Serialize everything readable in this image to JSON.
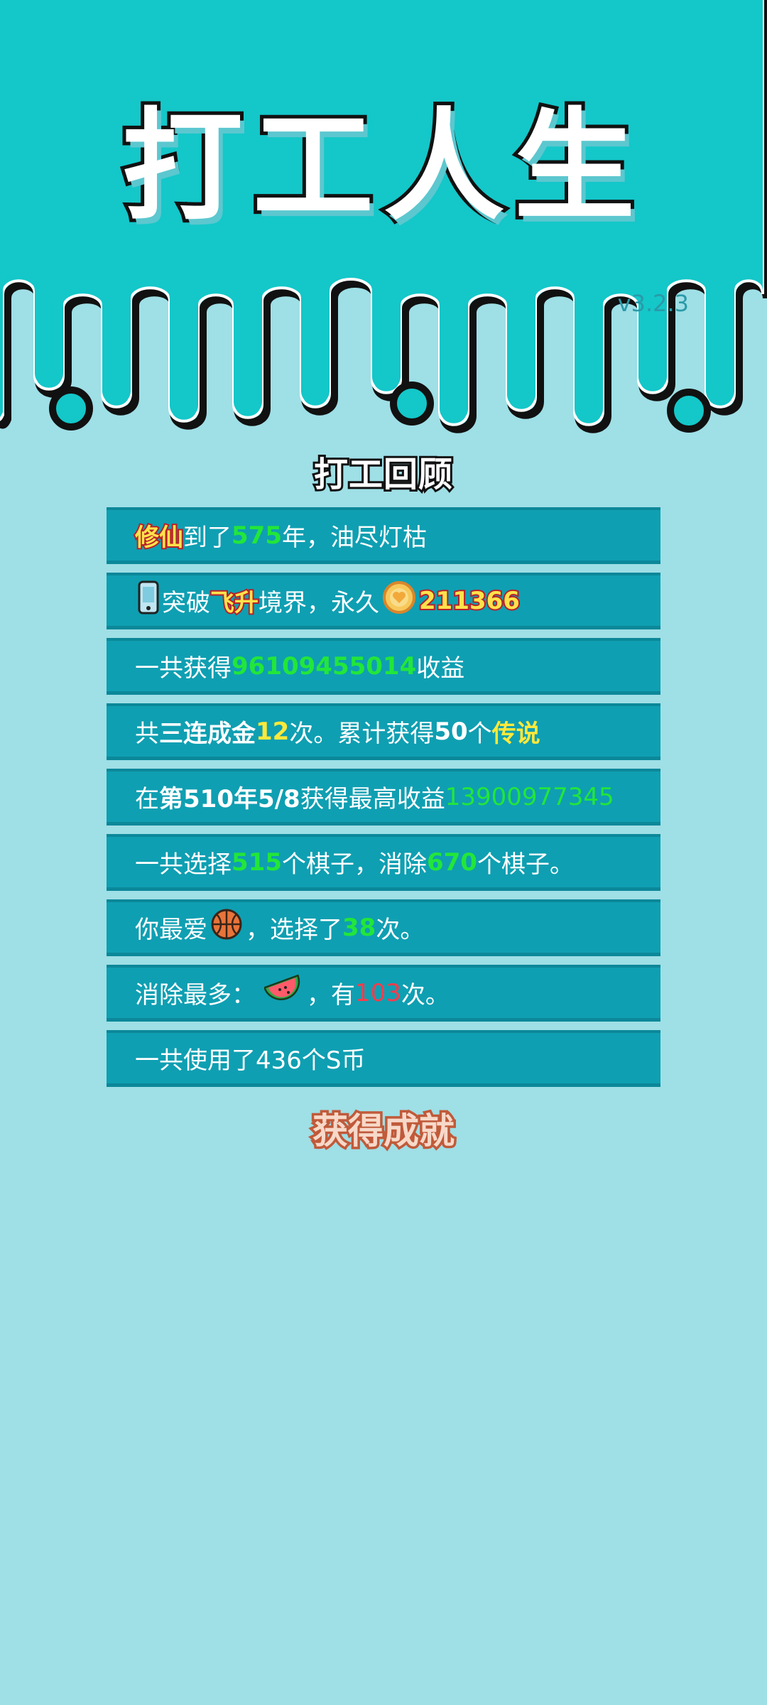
{
  "header": {
    "title": "打工人生",
    "version": "v3.2.3",
    "bg_color": "#14c7c9"
  },
  "review": {
    "title": "打工回顾",
    "rows": [
      {
        "id": "r1",
        "tag": "修仙",
        "t1": "到了",
        "years": "575",
        "t2": "年，油尽灯枯"
      },
      {
        "id": "r2",
        "t1": "突破",
        "tag": "飞升",
        "t2": "境界，永久",
        "coins": "211366",
        "icon_a": "phone-icon",
        "icon_b": "coin-icon"
      },
      {
        "id": "r3",
        "t1": "一共获得",
        "income": "96109455014",
        "t2": "收益"
      },
      {
        "id": "r4",
        "t1": "共",
        "combo": "三连成金",
        "count": "12",
        "t2": "次。累计获得",
        "legend_count": "50",
        "t3": "个",
        "legend": "传说"
      },
      {
        "id": "r5",
        "t1": "在 ",
        "date": "第510年5/8",
        "t2": " 获得最高收益",
        "max": "13900977345"
      },
      {
        "id": "r6",
        "t1": "一共选择",
        "chosen": "515",
        "t2": "个棋子，消除",
        "removed": "670",
        "t3": "个棋子。"
      },
      {
        "id": "r7",
        "t1": "你最爱",
        "t2": "，选择了",
        "times": "38",
        "t3": "次。",
        "icon": "basketball-icon"
      },
      {
        "id": "r8",
        "t1": "消除最多：",
        "t2": "，有",
        "times": "103",
        "t3": "次。",
        "icon": "watermelon-icon"
      },
      {
        "id": "r9",
        "t1": "一共使用了436个S币"
      }
    ]
  },
  "achievements": {
    "title": "获得成就"
  },
  "colors": {
    "background": "#9fdfe6",
    "row": "#0f9fb2",
    "green": "#22e63a",
    "yellow": "#ffe93a",
    "red": "#ff3b4a"
  }
}
